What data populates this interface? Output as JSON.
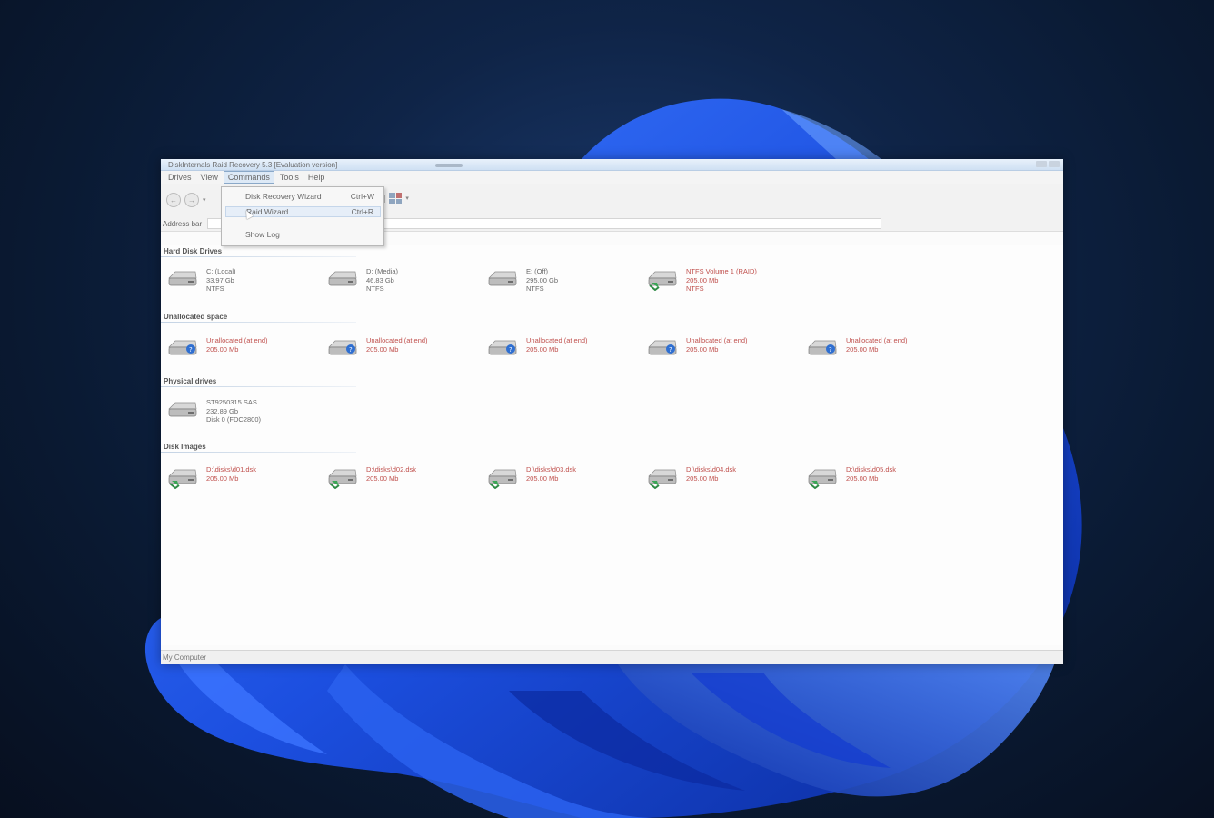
{
  "window": {
    "title": "DiskInternals Raid Recovery 5.3 [Evaluation version]"
  },
  "menubar": [
    "Drives",
    "View",
    "Commands",
    "Tools",
    "Help"
  ],
  "commands_menu": [
    {
      "label": "Disk Recovery Wizard",
      "shortcut": "Ctrl+W"
    },
    {
      "label": "Raid Wizard",
      "shortcut": "Ctrl+R"
    },
    {
      "label": "Show Log",
      "shortcut": ""
    }
  ],
  "address_bar": {
    "label": "Address bar"
  },
  "sections": {
    "hard_disks": {
      "title": "Hard Disk Drives",
      "items": [
        {
          "lines": [
            "C: (Local)",
            "33.97 Gb",
            "NTFS"
          ],
          "red": false,
          "icon": "hdd"
        },
        {
          "lines": [
            "D: (Media)",
            "46.83 Gb",
            "NTFS"
          ],
          "red": false,
          "icon": "hdd"
        },
        {
          "lines": [
            "E: (Off)",
            "295.00 Gb",
            "NTFS"
          ],
          "red": false,
          "icon": "hdd"
        },
        {
          "lines": [
            "NTFS Volume 1 (RAID)",
            "205.00 Mb",
            "NTFS"
          ],
          "red": true,
          "icon": "hdd-green"
        }
      ]
    },
    "unallocated": {
      "title": "Unallocated space",
      "items": [
        {
          "lines": [
            "Unallocated (at end)",
            "205.00 Mb"
          ],
          "red": true,
          "icon": "hdd-blue"
        },
        {
          "lines": [
            "Unallocated (at end)",
            "205.00 Mb"
          ],
          "red": true,
          "icon": "hdd-blue"
        },
        {
          "lines": [
            "Unallocated (at end)",
            "205.00 Mb"
          ],
          "red": true,
          "icon": "hdd-blue"
        },
        {
          "lines": [
            "Unallocated (at end)",
            "205.00 Mb"
          ],
          "red": true,
          "icon": "hdd-blue"
        },
        {
          "lines": [
            "Unallocated (at end)",
            "205.00 Mb"
          ],
          "red": true,
          "icon": "hdd-blue"
        }
      ]
    },
    "physical": {
      "title": "Physical drives",
      "items": [
        {
          "lines": [
            "ST9250315 SAS",
            "232.89 Gb",
            "Disk 0 (FDC2800)"
          ],
          "red": false,
          "icon": "hdd"
        }
      ]
    },
    "images": {
      "title": "Disk Images",
      "items": [
        {
          "lines": [
            "D:\\disks\\d01.dsk",
            "205.00 Mb"
          ],
          "red": true,
          "icon": "hdd-green"
        },
        {
          "lines": [
            "D:\\disks\\d02.dsk",
            "205.00 Mb"
          ],
          "red": true,
          "icon": "hdd-green"
        },
        {
          "lines": [
            "D:\\disks\\d03.dsk",
            "205.00 Mb"
          ],
          "red": true,
          "icon": "hdd-green"
        },
        {
          "lines": [
            "D:\\disks\\d04.dsk",
            "205.00 Mb"
          ],
          "red": true,
          "icon": "hdd-green"
        },
        {
          "lines": [
            "D:\\disks\\d05.dsk",
            "205.00 Mb"
          ],
          "red": true,
          "icon": "hdd-green"
        }
      ]
    }
  },
  "statusbar": {
    "text": "My Computer"
  },
  "colors": {
    "accent_red": "#c0504d",
    "bloom_blue": "#1f4fd8"
  }
}
